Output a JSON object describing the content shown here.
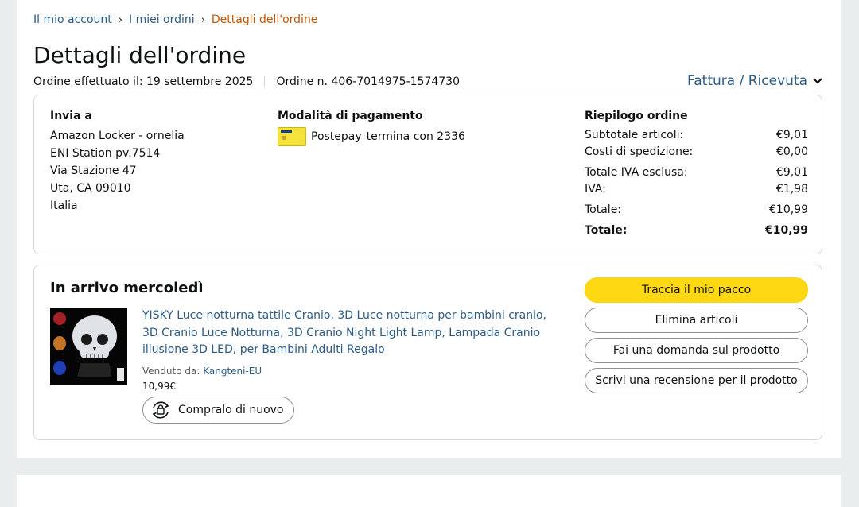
{
  "breadcrumb": {
    "account": "Il mio account",
    "orders": "I miei ordini",
    "current": "Dettagli dell'ordine",
    "separator": "›"
  },
  "page_title": "Dettagli dell'ordine",
  "order_meta": {
    "placed": "Ordine effettuato il: 19 settembre 2025",
    "number": "Ordine n. 406-7014975-1574730"
  },
  "invoice_link": "Fattura / Ricevuta",
  "shipping": {
    "heading": "Invia a",
    "lines": [
      "Amazon Locker - ornelia",
      "ENI Station pv.7514",
      "Via Stazione 47",
      "Uta, CA 09010",
      "Italia"
    ]
  },
  "payment": {
    "heading": "Modalità di pagamento",
    "card_brand": "Postepay",
    "card_ending": "termina con 2336",
    "card_icon": "postepay-card-icon"
  },
  "summary": {
    "heading": "Riepilogo ordine",
    "rows": [
      {
        "label": "Subtotale articoli:",
        "value": "€9,01"
      },
      {
        "label": "Costi di spedizione:",
        "value": "€0,00"
      },
      {
        "label": "Totale IVA esclusa:",
        "value": "€9,01"
      },
      {
        "label": "IVA:",
        "value": "€1,98"
      },
      {
        "label": "Totale:",
        "value": "€10,99"
      },
      {
        "label": "Totale:",
        "value": "€10,99"
      }
    ]
  },
  "shipment": {
    "title": "In arrivo mercoledì",
    "product": {
      "title": "YISKY Luce notturna tattile Cranio, 3D Luce notturna per bambini cranio, 3D Cranio Luce Notturna, 3D Cranio Night Light Lamp, Lampada Cranio illusione 3D LED, per Bambini Adulti Regalo",
      "sold_by_label": "Venduto da:",
      "seller": "Kangteni-EU",
      "price": "10,99€",
      "buy_again": "Compralo di nuovo"
    },
    "actions": {
      "track": "Traccia il mio pacco",
      "delete": "Elimina articoli",
      "question": "Fai una domanda sul prodotto",
      "review": "Scrivi una recensione per il prodotto"
    }
  },
  "colors": {
    "link": "#2b5b84",
    "breadcrumb_current": "#c45500",
    "primary_button": "#ffd814",
    "border": "#d5d9d9"
  }
}
